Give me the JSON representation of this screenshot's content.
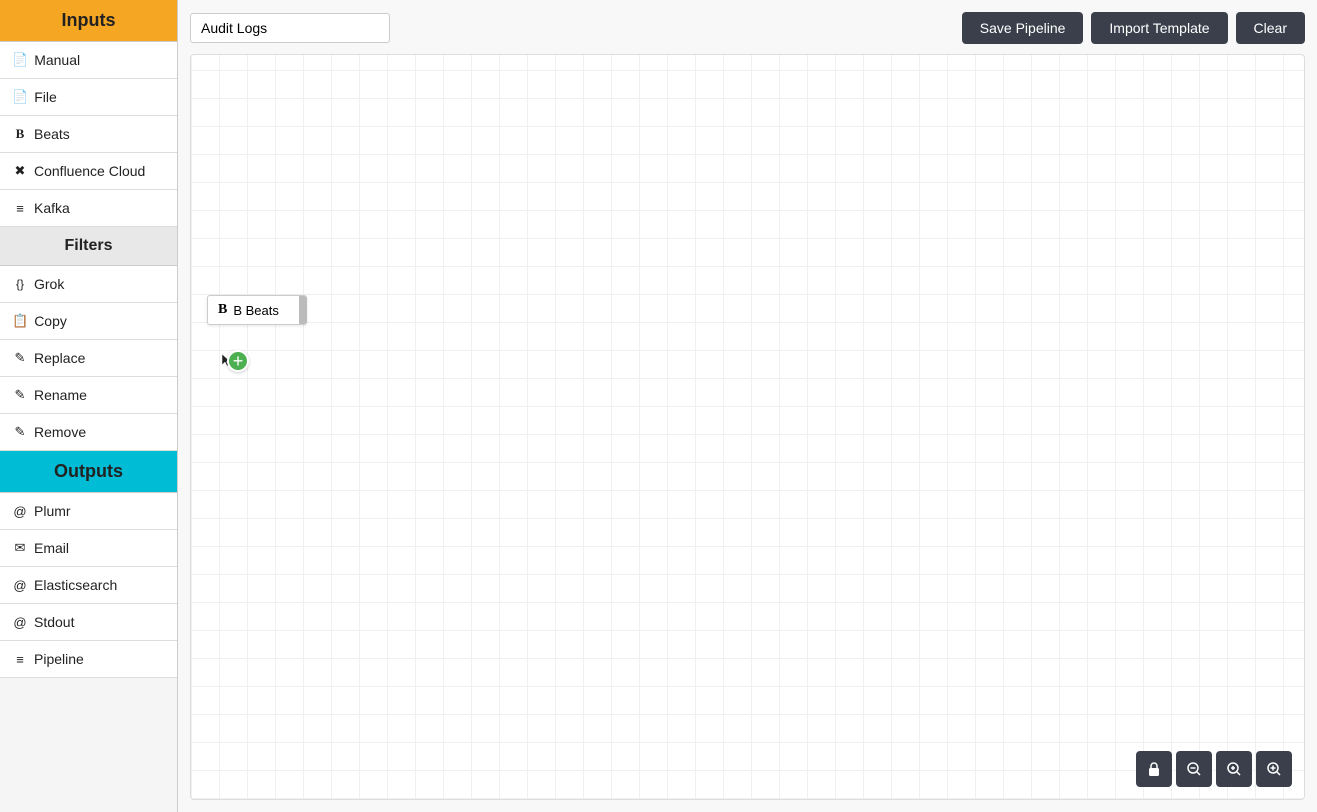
{
  "sidebar": {
    "inputs_header": "Inputs",
    "filters_header": "Filters",
    "outputs_header": "Outputs",
    "inputs": [
      {
        "label": "Manual",
        "icon": "📄"
      },
      {
        "label": "File",
        "icon": "📄"
      },
      {
        "label": "Beats",
        "icon": "B"
      },
      {
        "label": "Confluence Cloud",
        "icon": "✖"
      },
      {
        "label": "Kafka",
        "icon": "≡"
      }
    ],
    "filters": [
      {
        "label": "Grok",
        "icon": "{}"
      },
      {
        "label": "Copy",
        "icon": "📋"
      },
      {
        "label": "Replace",
        "icon": "✎"
      },
      {
        "label": "Rename",
        "icon": "✎"
      },
      {
        "label": "Remove",
        "icon": "✎"
      }
    ],
    "outputs": [
      {
        "label": "Plumr",
        "icon": "@"
      },
      {
        "label": "Email",
        "icon": "✉"
      },
      {
        "label": "Elasticsearch",
        "icon": "@"
      },
      {
        "label": "Stdout",
        "icon": "@"
      },
      {
        "label": "Pipeline",
        "icon": "≡"
      }
    ]
  },
  "header": {
    "pipeline_name": "Audit Logs",
    "save_button": "Save Pipeline",
    "import_button": "Import Template",
    "clear_button": "Clear"
  },
  "canvas": {
    "beats_node_label": "B Beats",
    "add_tooltip": "+"
  },
  "toolbar": {
    "lock_icon": "🔒",
    "zoom_out_icon": "🔍",
    "zoom_reset_icon": "🔍",
    "zoom_in_icon": "🔍"
  }
}
